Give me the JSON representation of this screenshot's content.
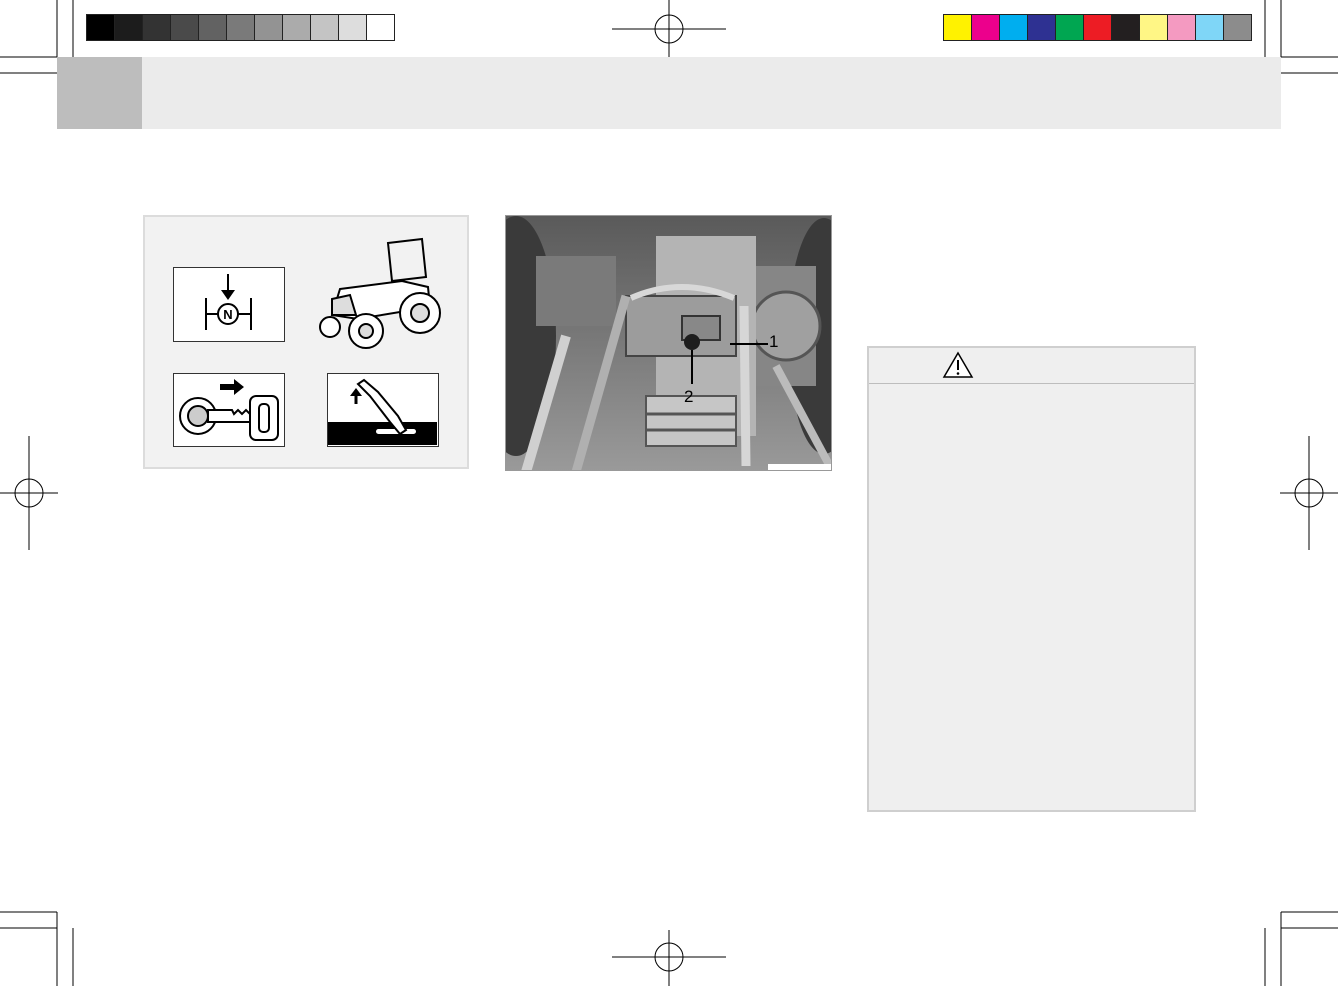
{
  "print_marks": {
    "grayscale_bar": [
      "#000000",
      "#1c1c1c",
      "#333333",
      "#4a4a4a",
      "#626262",
      "#7a7a7a",
      "#939393",
      "#ababab",
      "#c4c4c4",
      "#dddddd",
      "#ffffff"
    ],
    "color_bar": [
      "#fff200",
      "#ec008c",
      "#00aeef",
      "#2e3192",
      "#00a651",
      "#ed1c24",
      "#231f20",
      "#fff685",
      "#f49ac1",
      "#7fd6f7",
      "#8c8c8c"
    ]
  },
  "header": {
    "title": ""
  },
  "illustration": {
    "icons": [
      "neutral-gear-icon",
      "tractor-icon",
      "key-remove-icon",
      "parking-brake-icon"
    ],
    "neutral_label": "N"
  },
  "photo": {
    "callouts": [
      {
        "label": "1"
      },
      {
        "label": "2"
      }
    ]
  },
  "warning": {
    "icon": "warning-triangle-icon",
    "colors": {
      "box": "#efefef",
      "border": "#cfcfcf"
    }
  }
}
